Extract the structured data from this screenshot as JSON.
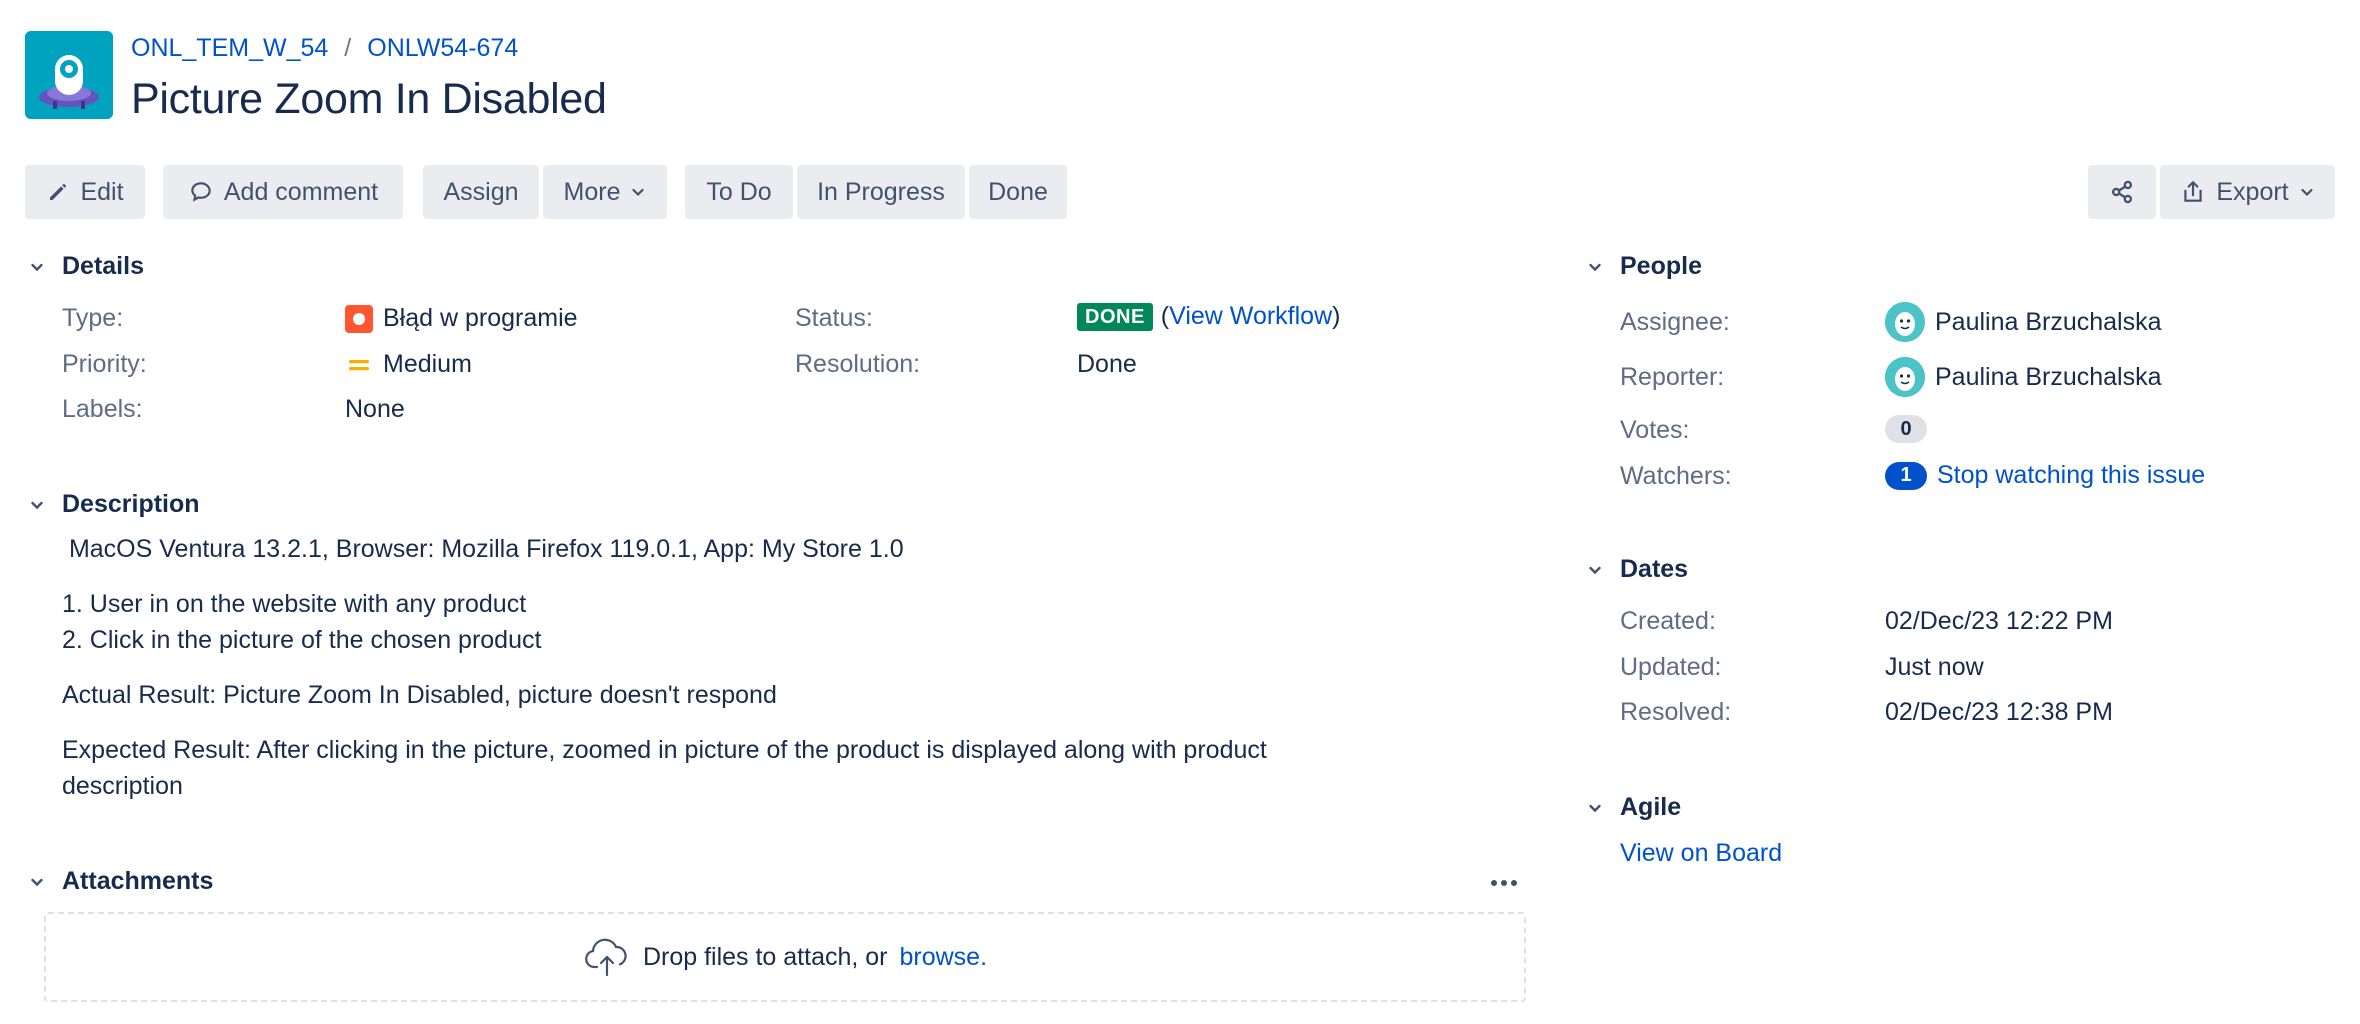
{
  "header": {
    "project_link": "ONL_TEM_W_54",
    "separator": "/",
    "issue_key": "ONLW54-674",
    "title": "Picture Zoom In Disabled"
  },
  "toolbar": {
    "edit": "Edit",
    "add_comment": "Add comment",
    "assign": "Assign",
    "more": "More",
    "todo": "To Do",
    "in_progress": "In Progress",
    "done": "Done",
    "export": "Export"
  },
  "details": {
    "heading": "Details",
    "type_label": "Type:",
    "type_value": "Błąd w programie",
    "priority_label": "Priority:",
    "priority_value": "Medium",
    "labels_label": "Labels:",
    "labels_value": "None",
    "status_label": "Status:",
    "status_value": "DONE",
    "view_workflow_open": "(",
    "view_workflow": "View Workflow",
    "view_workflow_close": ")",
    "resolution_label": "Resolution:",
    "resolution_value": "Done"
  },
  "description": {
    "heading": "Description",
    "line1": " MacOS Ventura 13.2.1, Browser: Mozilla Firefox 119.0.1, App: My Store 1.0",
    "step1": "1. User in on the website with any product",
    "step2": "2. Click in the picture of the chosen product",
    "actual": "Actual Result: Picture Zoom In Disabled, picture doesn't respond",
    "expected": "Expected Result: After clicking in the picture, zoomed in picture of the product is displayed along with product description"
  },
  "attachments": {
    "heading": "Attachments",
    "drop_text": "Drop files to attach, or",
    "browse": "browse."
  },
  "people": {
    "heading": "People",
    "assignee_label": "Assignee:",
    "assignee": "Paulina Brzuchalska",
    "reporter_label": "Reporter:",
    "reporter": "Paulina Brzuchalska",
    "votes_label": "Votes:",
    "votes": "0",
    "watchers_label": "Watchers:",
    "watchers": "1",
    "stop_watching": "Stop watching this issue"
  },
  "dates": {
    "heading": "Dates",
    "created_label": "Created:",
    "created": "02/Dec/23 12:22 PM",
    "updated_label": "Updated:",
    "updated": "Just now",
    "resolved_label": "Resolved:",
    "resolved": "02/Dec/23 12:38 PM"
  },
  "agile": {
    "heading": "Agile",
    "view_on_board": "View on Board"
  },
  "colors": {
    "link": "#0052cc",
    "done_lozenge": "#00875a",
    "bug_type": "#ff5630",
    "priority_medium": "#ffab00",
    "project_avatar_bg": "#00a3bf"
  },
  "icons": [
    "project-avatar",
    "pencil-icon",
    "comment-icon",
    "chevron-down-icon",
    "share-icon",
    "export-icon",
    "bug-icon",
    "priority-medium-icon",
    "user-avatar",
    "more-icon",
    "cloud-upload-icon"
  ]
}
